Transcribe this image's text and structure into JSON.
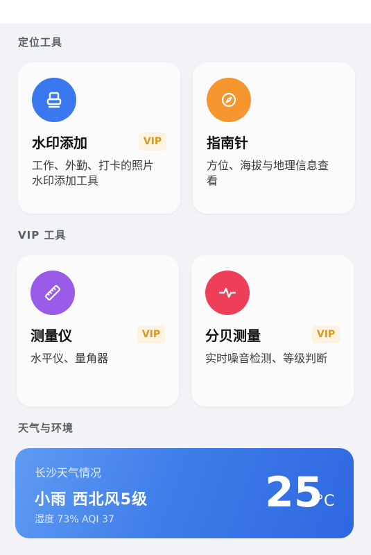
{
  "sections": {
    "location": "定位工具",
    "vip": "VIP 工具",
    "weather": "天气与环境"
  },
  "cards": [
    {
      "name": "水印添加",
      "badge": "VIP",
      "desc": "工作、外勤、打卡的照片水印添加工具",
      "icon": "stamp-icon",
      "color": "#3a78f0"
    },
    {
      "name": "指南针",
      "badge": "",
      "desc": "方位、海拔与地理信息查看",
      "icon": "compass-icon",
      "color": "#f5962f"
    },
    {
      "name": "测量仪",
      "badge": "VIP",
      "desc": "水平仪、量角器",
      "icon": "ruler-icon",
      "color": "#9a5ce8"
    },
    {
      "name": "分贝测量",
      "badge": "VIP",
      "desc": "实时噪音检测、等级判断",
      "icon": "pulse-icon",
      "color": "#ee3f5a"
    }
  ],
  "weather": {
    "title": "长沙天气情况",
    "condition": "小雨 西北风5级",
    "details": "湿度 73% AQI 37",
    "temperature": "25",
    "unit": "°C"
  }
}
